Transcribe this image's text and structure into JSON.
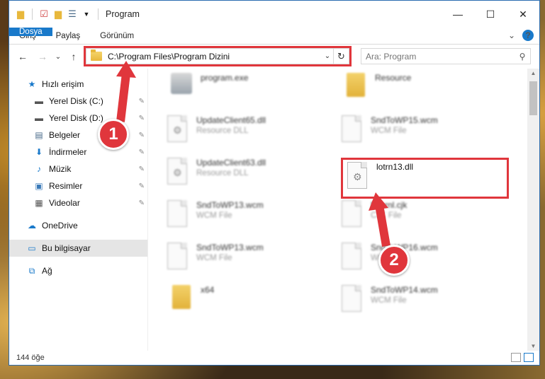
{
  "window": {
    "title": "Program",
    "minimize": "—",
    "maximize": "☐",
    "close": "✕"
  },
  "ribbon": {
    "tabs": [
      "Dosya",
      "Giriş",
      "Paylaş",
      "Görünüm"
    ],
    "expand": "⌄",
    "help": "?"
  },
  "nav": {
    "back": "←",
    "forward": "→",
    "recent": "⌄",
    "up": "↑",
    "address_path": "C:\\Program Files\\Program Dizini",
    "address_dropdown": "⌄",
    "refresh": "↻",
    "search_placeholder": "Ara: Program",
    "search_icon": "⚲"
  },
  "sidebar": {
    "items": [
      {
        "label": "Hızlı erişim",
        "icon": "star-icon",
        "glyph": "★",
        "color": "#1979ca"
      },
      {
        "label": "Yerel Disk (C:)",
        "icon": "drive-icon",
        "glyph": "▬",
        "color": "#555555",
        "pinned": true
      },
      {
        "label": "Yerel Disk (D:)",
        "icon": "drive-icon",
        "glyph": "▬",
        "color": "#555555",
        "pinned": true
      },
      {
        "label": "Belgeler",
        "icon": "documents-icon",
        "glyph": "▤",
        "color": "#4a6b8a",
        "pinned": true
      },
      {
        "label": "İndirmeler",
        "icon": "download-icon",
        "glyph": "⬇",
        "color": "#1979ca",
        "pinned": true
      },
      {
        "label": "Müzik",
        "icon": "music-icon",
        "glyph": "♪",
        "color": "#1979ca",
        "pinned": true
      },
      {
        "label": "Resimler",
        "icon": "pictures-icon",
        "glyph": "▣",
        "color": "#3a7ab8",
        "pinned": true
      },
      {
        "label": "Videolar",
        "icon": "video-icon",
        "glyph": "▦",
        "color": "#555555",
        "pinned": true
      },
      {
        "label": "OneDrive",
        "icon": "cloud-icon",
        "glyph": "☁",
        "color": "#1979ca"
      },
      {
        "label": "Bu bilgisayar",
        "icon": "computer-icon",
        "glyph": "▭",
        "color": "#1979ca",
        "selected": true
      },
      {
        "label": "Ağ",
        "icon": "network-icon",
        "glyph": "⧉",
        "color": "#1979ca"
      }
    ],
    "pin_glyph": "✎"
  },
  "files": [
    {
      "name": "program.exe",
      "type": "",
      "icon": "exe-icon"
    },
    {
      "name": "Resource",
      "type": "",
      "icon": "folder-icon"
    },
    {
      "name": "UpdateClient65.dll",
      "type": "Resource DLL",
      "icon": "dll-icon"
    },
    {
      "name": "SndToWP15.wcm",
      "type": "WCM File",
      "icon": "file-icon"
    },
    {
      "name": "UpdateClient63.dll",
      "type": "Resource DLL",
      "icon": "dll-icon"
    },
    {
      "name": "lotrn13.dll",
      "type": "",
      "icon": "dll-icon"
    },
    {
      "name": "SndToWP13.wcm",
      "type": "WCM File",
      "icon": "file-icon"
    },
    {
      "name": "Mmrnl.cjk",
      "type": "CJK File",
      "icon": "file-icon"
    },
    {
      "name": "SndToWP13.wcm",
      "type": "WCM File",
      "icon": "file-icon"
    },
    {
      "name": "SndToWP16.wcm",
      "type": "WCM File",
      "icon": "file-icon"
    },
    {
      "name": "x64",
      "type": "",
      "icon": "folder-icon"
    },
    {
      "name": "SndToWP14.wcm",
      "type": "WCM File",
      "icon": "file-icon"
    }
  ],
  "status": {
    "item_count": "144 öğe"
  },
  "callouts": {
    "one": "1",
    "two": "2"
  },
  "colors": {
    "accent": "#1979ca",
    "highlight_red": "#e0363c"
  }
}
